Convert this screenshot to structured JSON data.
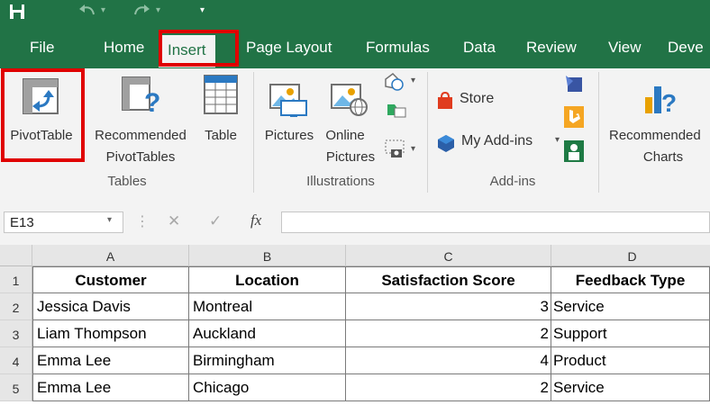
{
  "ribbon_tabs": [
    "File",
    "Home",
    "Insert",
    "Page Layout",
    "Formulas",
    "Data",
    "Review",
    "View",
    "Deve"
  ],
  "ribbon": {
    "pivottable": "PivotTable",
    "recommended_pivot_1": "Recommended",
    "recommended_pivot_2": "PivotTables",
    "table": "Table",
    "pictures": "Pictures",
    "online_1": "Online",
    "online_2": "Pictures",
    "store": "Store",
    "my_addins": "My Add-ins",
    "rec_charts_1": "Recommended",
    "rec_charts_2": "Charts",
    "groups": {
      "tables": "Tables",
      "illustrations": "Illustrations",
      "addins": "Add-ins"
    }
  },
  "formula_bar": {
    "name_box": "E13",
    "fx": "fx",
    "cancel": "✕",
    "enter": "✓"
  },
  "sheet": {
    "columns": [
      "A",
      "B",
      "C",
      "D"
    ],
    "row_numbers": [
      "1",
      "2",
      "3",
      "4",
      "5"
    ],
    "header": [
      "Customer",
      "Location",
      "Satisfaction Score",
      "Feedback Type"
    ],
    "rows": [
      [
        "Jessica Davis",
        "Montreal",
        "3",
        "Service"
      ],
      [
        "Liam Thompson",
        "Auckland",
        "2",
        "Support"
      ],
      [
        "Emma Lee",
        "Birmingham",
        "4",
        "Product"
      ],
      [
        "Emma Lee",
        "Chicago",
        "2",
        "Service"
      ]
    ]
  },
  "colors": {
    "excel_green": "#217346",
    "highlight_red": "#e00000",
    "ribbon_bg": "#f3f3f3"
  }
}
